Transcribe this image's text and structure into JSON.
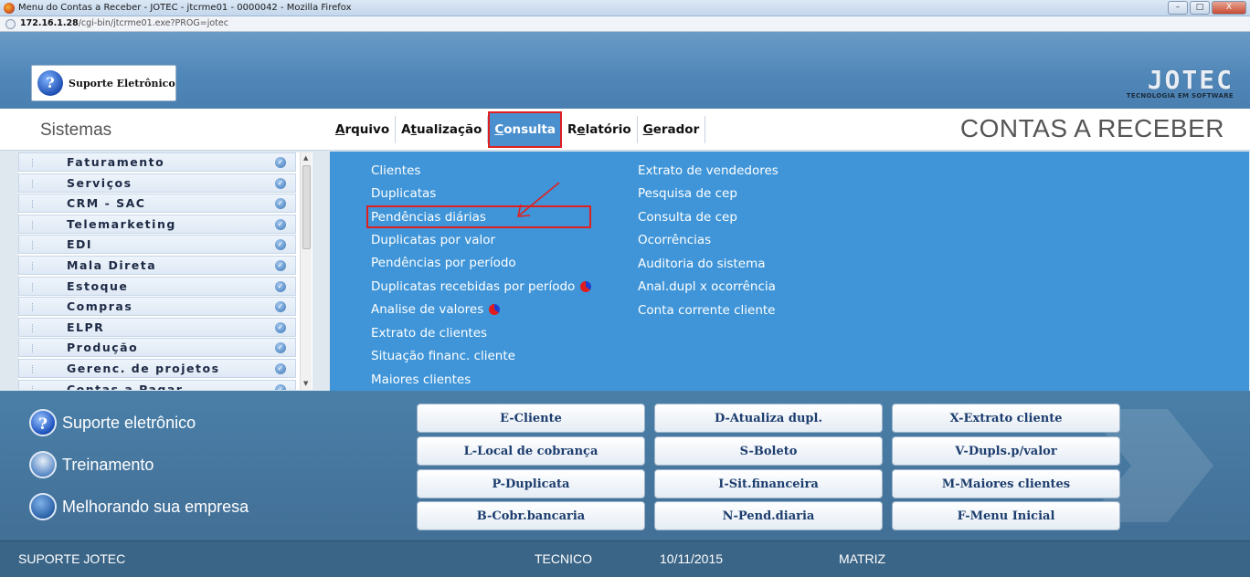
{
  "window": {
    "title": "Menu do Contas a Receber - JOTEC - jtcrme01 - 0000042 - Mozilla Firefox",
    "url_host": "172.16.1.28",
    "url_path": "/cgi-bin/jtcrme01.exe?PROG=jotec",
    "minimize": "–",
    "maximize": "□",
    "close": "X"
  },
  "header": {
    "support_button": "Suporte Eletrônico",
    "logo_word": "JOTEC",
    "logo_tagline": "TECNOLOGIA EM SOFTWARE"
  },
  "sistemas_title": "Sistemas",
  "module_title": "CONTAS A RECEBER",
  "menu": [
    {
      "pre": "",
      "key": "A",
      "post": "rquivo",
      "active": false
    },
    {
      "pre": "A",
      "key": "t",
      "post": "ualização",
      "active": false
    },
    {
      "pre": "",
      "key": "C",
      "post": "onsulta",
      "active": true
    },
    {
      "pre": "R",
      "key": "e",
      "post": "latório",
      "active": false
    },
    {
      "pre": "",
      "key": "G",
      "post": "erador",
      "active": false
    }
  ],
  "sidebar": {
    "items": [
      "Faturamento",
      "Serviços",
      "CRM - SAC",
      "Telemarketing",
      "EDI",
      "Mala Direta",
      "Estoque",
      "Compras",
      "ELPR",
      "Produção",
      "Gerenc. de projetos",
      "Contas a Pagar"
    ]
  },
  "dropdown": {
    "col1": [
      {
        "label": "Clientes",
        "pie": false
      },
      {
        "label": "Duplicatas",
        "pie": false
      },
      {
        "label": "Pendências diárias",
        "pie": false,
        "highlight": true
      },
      {
        "label": "Duplicatas por valor",
        "pie": false
      },
      {
        "label": "Pendências por período",
        "pie": false
      },
      {
        "label": "Duplicatas recebidas por período",
        "pie": true
      },
      {
        "label": "Analise de valores",
        "pie": true
      },
      {
        "label": "Extrato de clientes",
        "pie": false
      },
      {
        "label": "Situação financ. cliente",
        "pie": false
      },
      {
        "label": "Maiores clientes",
        "pie": false
      }
    ],
    "col2": [
      {
        "label": "Extrato de vendedores",
        "pie": false
      },
      {
        "label": "Pesquisa de cep",
        "pie": false
      },
      {
        "label": "Consulta de cep",
        "pie": false
      },
      {
        "label": "Ocorrências",
        "pie": false
      },
      {
        "label": "Auditoria do sistema",
        "pie": false
      },
      {
        "label": "Anal.dupl x ocorrência",
        "pie": false
      },
      {
        "label": "Conta corrente cliente",
        "pie": false
      }
    ]
  },
  "bottom_links": {
    "suporte": "Suporte eletrônico",
    "treinamento": "Treinamento",
    "melhorando": "Melhorando sua empresa"
  },
  "quick_buttons": [
    [
      "E-Cliente",
      "D-Atualiza dupl.",
      "X-Extrato cliente"
    ],
    [
      "L-Local de cobrança",
      "S-Boleto",
      "V-Dupls.p/valor"
    ],
    [
      "P-Duplicata",
      "I-Sit.financeira",
      "M-Maiores clientes"
    ],
    [
      "B-Cobr.bancaria",
      "N-Pend.diaria",
      "F-Menu Inicial"
    ]
  ],
  "status": {
    "left": "SUPORTE JOTEC",
    "user": "TECNICO",
    "date": "10/11/2015",
    "branch": "MATRIZ"
  },
  "colors": {
    "dropdown_bg": "#3f95d8",
    "highlight_border": "#e02020",
    "statusbar_bg": "#3b6587"
  }
}
